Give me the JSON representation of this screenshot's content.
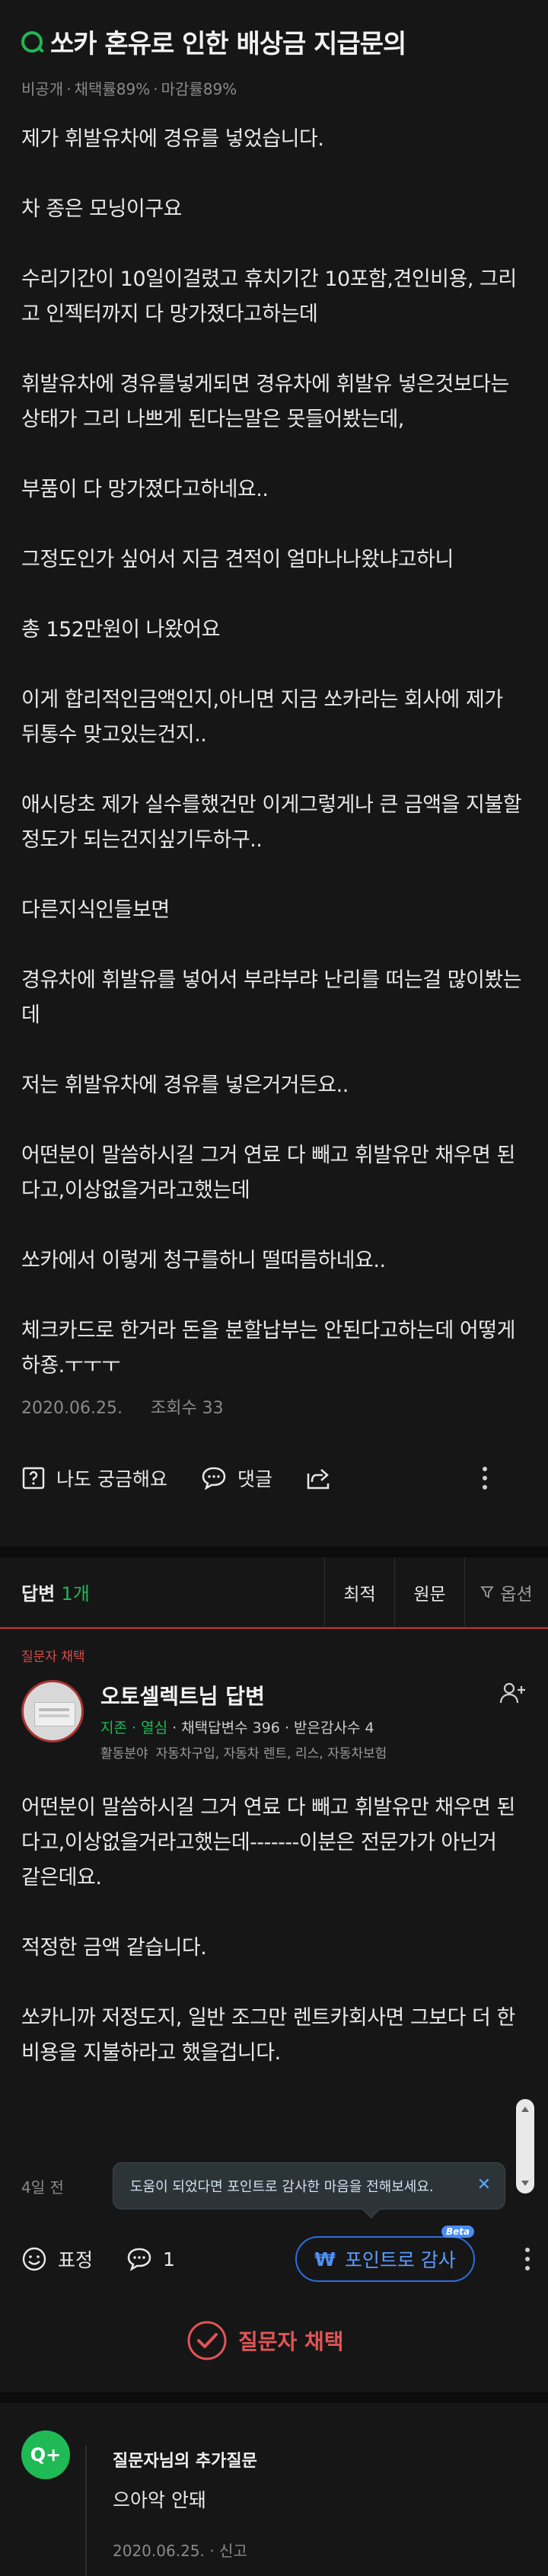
{
  "question": {
    "title": "쏘카 혼유로 인한 배상금 지급문의",
    "meta": {
      "visibility": "비공개",
      "adopt_rate": "채택률89%",
      "close_rate": "마감률89%"
    },
    "paragraphs": [
      "제가 휘발유차에 경유를 넣었습니다.",
      "차 종은 모닝이구요",
      "수리기간이 10일이걸렸고 휴치기간 10포함,견인비용, 그리고 인젝터까지 다 망가졌다고하는데",
      "휘발유차에 경유를넣게되면 경유차에 휘발유 넣은것보다는 상태가 그리 나쁘게 된다는말은 못들어봤는데,",
      "부품이 다 망가졌다고하네요..",
      "그정도인가 싶어서 지금 견적이 얼마나나왔냐고하니",
      "총 152만원이 나왔어요",
      "이게 합리적인금액인지,아니면 지금 쏘카라는 회사에 제가 뒤통수 맞고있는건지..",
      "애시당초 제가 실수를했건만 이게그렇게나 큰 금액을 지불할정도가 되는건지싶기두하구..",
      "다른지식인들보면",
      "경유차에 휘발유를 넣어서 부랴부랴 난리를 떠는걸 많이봤는데",
      "저는 휘발유차에 경유를 넣은거거든요..",
      "어떤분이 말씀하시길 그거 연료 다 빼고 휘발유만 채우면 된다고,이상없을거라고했는데",
      "쏘카에서 이렇게 청구를하니 떨떠름하네요..",
      "체크카드로 한거라 돈을 분할납부는 안된다고하는데 어떻게하죵.ㅜㅜㅜ"
    ],
    "date": "2020.06.25.",
    "views": "조회수 33",
    "actions": {
      "curious": "나도 궁금해요",
      "comment": "댓글"
    }
  },
  "answers_bar": {
    "label": "답변",
    "count": "1개",
    "sort_best": "최적",
    "sort_original": "원문",
    "filter": "옵션"
  },
  "answer": {
    "chosen_label": "질문자 채택",
    "author": "오토셀렉트님 답변",
    "level_grade": "지존",
    "level_title": "열심",
    "answer_count": "채택답변수 396",
    "thanks_count": "받은감사수 4",
    "field_label": "활동분야",
    "fields": "자동차구입, 자동차 렌트, 리스, 자동차보험",
    "paragraphs": [
      "어떤분이 말씀하시길 그거 연료 다 빼고 휘발유만 채우면 된다고,이상없을거라고했는데-------이분은 전문가가 아닌거 같은데요.",
      "적정한 금액 같습니다.",
      "쏘카니까 저정도지, 일반 조그만 렌트카회사면 그보다 더 한비용을 지불하라고 했을겁니다."
    ],
    "time": "4일 전",
    "tooltip": "도움이 되었다면 포인트로 감사한 마음을 전해보세요.",
    "expression_label": "표정",
    "comment_count": "1",
    "thanks_button": "포인트로 감사",
    "thanks_symbol": "₩",
    "beta": "Beta",
    "chosen_mark": "질문자 채택"
  },
  "followup": {
    "badge": "Q+",
    "title": "질문자님의 추가질문",
    "text": "으아악 안돼",
    "date": "2020.06.25.",
    "report": "신고"
  },
  "colors": {
    "accent_green": "#1fb955",
    "accent_red": "#e05555",
    "accent_blue": "#5d9bff",
    "background": "#161616"
  }
}
